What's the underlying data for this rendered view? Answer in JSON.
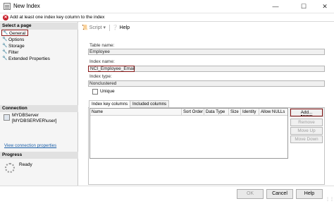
{
  "window": {
    "title": "New Index",
    "minimize_icon": "minimize-icon",
    "maximize_icon": "maximize-icon",
    "close_icon": "close-icon"
  },
  "message": {
    "text": "Add at least one index key column to the index",
    "icon": "error-icon",
    "icon_color": "#c8202b"
  },
  "sidebar": {
    "select_page_header": "Select a page",
    "pages": [
      {
        "label": "General",
        "selected": true
      },
      {
        "label": "Options",
        "selected": false
      },
      {
        "label": "Storage",
        "selected": false
      },
      {
        "label": "Filter",
        "selected": false
      },
      {
        "label": "Extended Properties",
        "selected": false
      }
    ],
    "connection_header": "Connection",
    "connection_server": "MYDBServer",
    "connection_user": "[MYDBSERVER\\user]",
    "view_connection_link": "View connection properties",
    "progress_header": "Progress",
    "progress_status": "Ready"
  },
  "toolbar": {
    "script_label": "Script",
    "help_label": "Help"
  },
  "form": {
    "table_name_label": "Table name:",
    "table_name_value": "Employee",
    "index_name_label": "Index name:",
    "index_name_value": "NCI_Employee_Email",
    "index_type_label": "Index type:",
    "index_type_value": "Nonclustered",
    "unique_label": "Unique",
    "unique_checked": false
  },
  "tabs": [
    {
      "label": "Index key columns",
      "active": true
    },
    {
      "label": "Included columns",
      "active": false
    }
  ],
  "grid": {
    "columns": [
      "Name",
      "Sort Order",
      "Data Type",
      "Size",
      "Identity",
      "Allow NULLs"
    ],
    "rows": []
  },
  "side_buttons": {
    "add": "Add...",
    "remove": "Remove",
    "move_up": "Move Up",
    "move_down": "Move Down"
  },
  "footer": {
    "ok": "OK",
    "cancel": "Cancel",
    "help": "Help"
  },
  "colors": {
    "highlight_border": "#8b1a1a",
    "link": "#1a5ea8"
  }
}
